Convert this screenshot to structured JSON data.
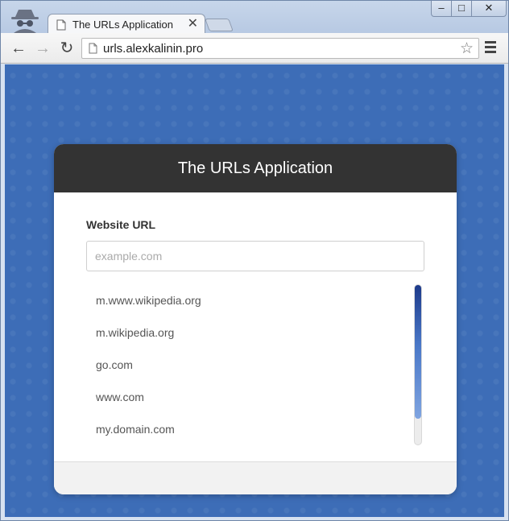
{
  "browser": {
    "tab_title": "The URLs Application",
    "tab_close_glyph": "✕",
    "address": "urls.alexkalinin.pro",
    "icons": {
      "incognito": "incognito-icon",
      "back": "back-arrow-icon",
      "forward": "forward-arrow-icon",
      "reload": "reload-icon",
      "star": "star-icon",
      "menu": "hamburger-menu-icon"
    }
  },
  "app": {
    "title": "The URLs Application",
    "field_label": "Website URL",
    "input_value": "",
    "input_placeholder": "example.com",
    "urls": [
      "m.www.wikipedia.org",
      "m.wikipedia.org",
      "go.com",
      "www.com",
      "my.domain.com"
    ]
  },
  "colors": {
    "page_background": "#3d6db7",
    "header_background": "#333333",
    "scrollbar_accent": "#1d3a8a"
  }
}
